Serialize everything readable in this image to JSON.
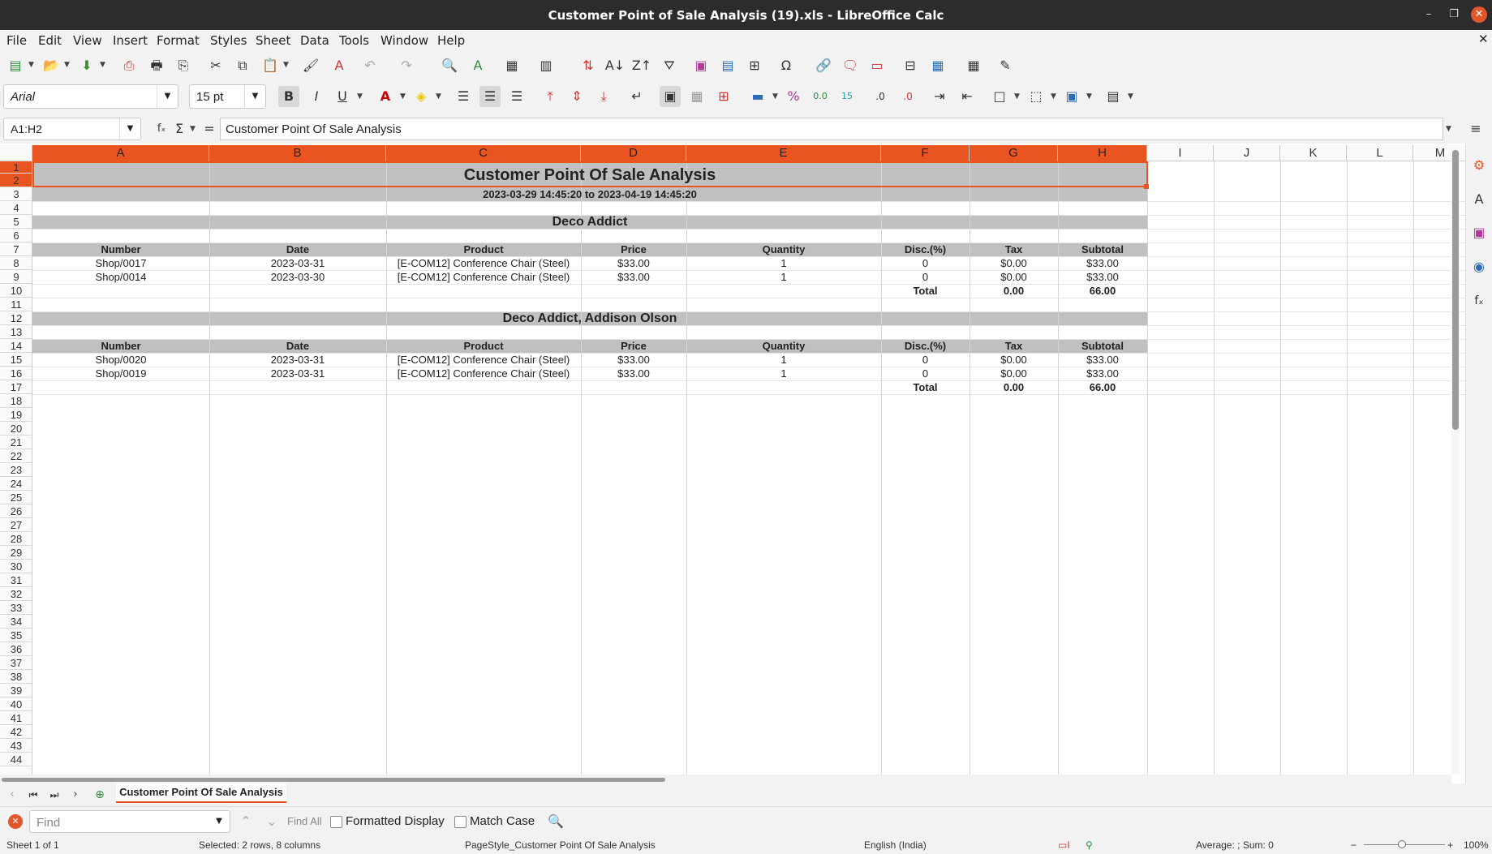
{
  "window": {
    "title": "Customer Point of Sale Analysis (19).xls - LibreOffice Calc"
  },
  "menu": [
    "File",
    "Edit",
    "View",
    "Insert",
    "Format",
    "Styles",
    "Sheet",
    "Data",
    "Tools",
    "Window",
    "Help"
  ],
  "toolbar": {
    "font_name": "Arial",
    "font_size": "15 pt"
  },
  "formula_bar": {
    "name_box": "A1:H2",
    "content": "Customer Point Of Sale Analysis"
  },
  "columns": [
    "A",
    "B",
    "C",
    "D",
    "E",
    "F",
    "G",
    "H",
    "I",
    "J",
    "K",
    "L",
    "M"
  ],
  "rows": [
    "1",
    "2",
    "3",
    "4",
    "5",
    "6",
    "7",
    "8",
    "9",
    "10",
    "11",
    "12",
    "13",
    "14",
    "15",
    "16",
    "17",
    "18",
    "19",
    "20",
    "21",
    "22",
    "23",
    "24",
    "25",
    "26",
    "27",
    "28",
    "29",
    "30",
    "31",
    "32",
    "33",
    "34",
    "35",
    "36",
    "37",
    "38",
    "39",
    "40",
    "41",
    "42",
    "43",
    "44"
  ],
  "sheet": {
    "title": "Customer Point Of Sale Analysis",
    "period": "2023-03-29 14:45:20 to 2023-04-19 14:45:20",
    "header": [
      "Number",
      "Date",
      "Product",
      "Price",
      "Quantity",
      "Disc.(%)",
      "Tax",
      "Subtotal"
    ],
    "groups": [
      {
        "name": "Deco Addict",
        "lines": [
          [
            "Shop/0017",
            "2023-03-31",
            "[E-COM12] Conference Chair (Steel)",
            "$33.00",
            "1",
            "0",
            "$0.00",
            "$33.00"
          ],
          [
            "Shop/0014",
            "2023-03-30",
            "[E-COM12] Conference Chair (Steel)",
            "$33.00",
            "1",
            "0",
            "$0.00",
            "$33.00"
          ]
        ],
        "total_label": "Total",
        "total_tax": "0.00",
        "total_subtotal": "66.00"
      },
      {
        "name": "Deco Addict, Addison Olson",
        "lines": [
          [
            "Shop/0020",
            "2023-03-31",
            "[E-COM12] Conference Chair (Steel)",
            "$33.00",
            "1",
            "0",
            "$0.00",
            "$33.00"
          ],
          [
            "Shop/0019",
            "2023-03-31",
            "[E-COM12] Conference Chair (Steel)",
            "$33.00",
            "1",
            "0",
            "$0.00",
            "$33.00"
          ]
        ],
        "total_label": "Total",
        "total_tax": "0.00",
        "total_subtotal": "66.00"
      }
    ]
  },
  "sheet_tab": "Customer Point Of Sale Analysis",
  "find": {
    "placeholder": "Find",
    "find_all": "Find All",
    "formatted_display": "Formatted Display",
    "match_case": "Match Case"
  },
  "status": {
    "sheet": "Sheet 1 of 1",
    "selection": "Selected: 2 rows, 8 columns",
    "page_style": "PageStyle_Customer Point Of Sale Analysis",
    "language": "English (India)",
    "sum": "Average: ; Sum: 0",
    "zoom": "100%"
  },
  "colors": {
    "accent": "#e95420",
    "band": "#c0c0c0",
    "titlebar": "#2c2c2c"
  }
}
